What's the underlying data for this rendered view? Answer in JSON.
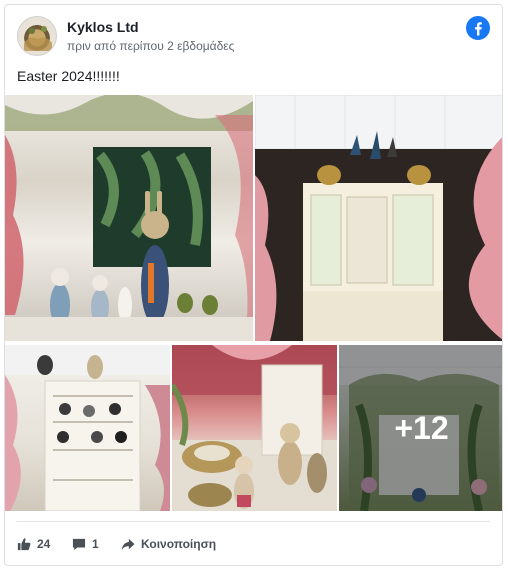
{
  "post": {
    "author": "Kyklos Ltd",
    "timestamp": "πριν από περίπου 2 εβδομάδες",
    "text": "Easter 2024!!!!!!!"
  },
  "gallery": {
    "more_count": "+12"
  },
  "actions": {
    "likes": "24",
    "comments": "1",
    "share_label": "Κοινοποίηση"
  },
  "colors": {
    "facebook_blue": "#1877f2",
    "text_secondary": "#606770"
  },
  "icons": {
    "brand": "facebook-icon",
    "like": "thumbs-up-icon",
    "comment": "comment-bubble-icon",
    "share": "share-arrow-icon"
  }
}
